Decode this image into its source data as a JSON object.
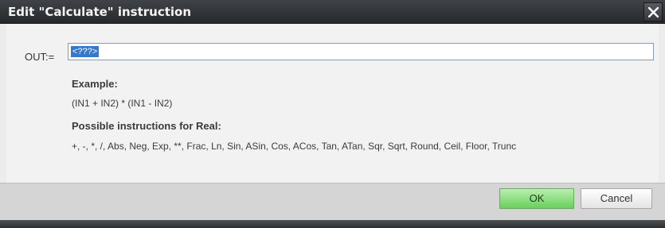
{
  "window": {
    "title": "Edit \"Calculate\" instruction"
  },
  "form": {
    "out_label": "OUT:=",
    "out_value": "<???>"
  },
  "help": {
    "example_title": "Example:",
    "example_text": "(IN1 + IN2) * (IN1 - IN2)",
    "possible_title": "Possible instructions for Real:",
    "possible_text": "+, -, *, /, Abs, Neg, Exp, **, Frac, Ln, Sin, ASin, Cos, ACos, Tan, ATan, Sqr, Sqrt, Round, Ceil, Floor, Trunc"
  },
  "buttons": {
    "ok": "OK",
    "cancel": "Cancel"
  },
  "icons": {
    "close": "close-icon"
  },
  "colors": {
    "titlebar": "#2f3236",
    "ok_accent": "#69cf5c",
    "selection": "#3478d0"
  }
}
